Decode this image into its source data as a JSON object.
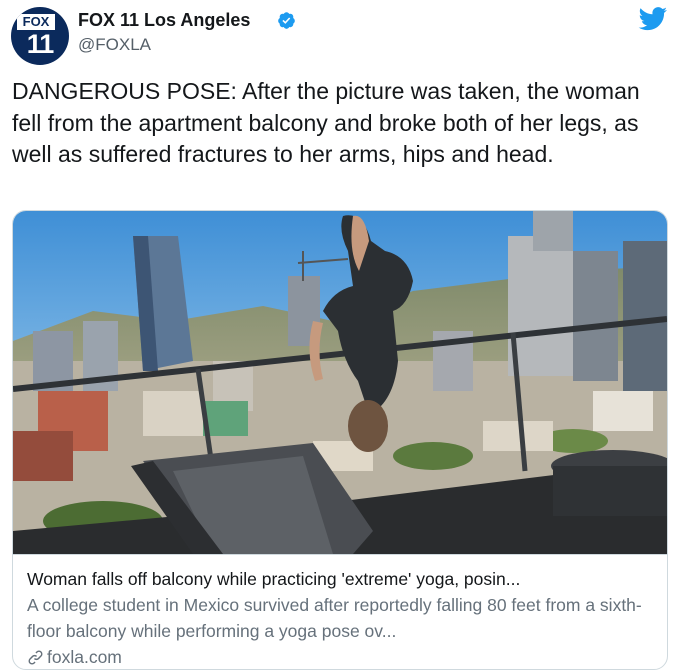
{
  "author": {
    "avatar_text_top": "FOX",
    "avatar_text_number": "11",
    "display_name": "FOX 11 Los Angeles",
    "handle": "@FOXLA",
    "verified_icon": "verified-badge-icon",
    "platform_icon": "twitter-bird-icon"
  },
  "tweet": {
    "text": "DANGEROUS POSE: After the picture was taken, the woman fell from the apartment balcony and broke both of her legs, as well as suffered fractures to her arms, hips and head."
  },
  "card": {
    "image_description_icon": "photo",
    "title": "Woman falls off balcony while practicing 'extreme' yoga, posin...",
    "description": "A college student in Mexico survived after reportedly falling 80 feet from a sixth-floor balcony while performing a yoga pose ov...",
    "domain": "foxla.com",
    "link_icon": "link-icon"
  },
  "colors": {
    "twitter_blue": "#1d9bf0",
    "fox_navy": "#0b2a5c",
    "secondary_text": "#66717b",
    "border": "#cfd9de"
  }
}
